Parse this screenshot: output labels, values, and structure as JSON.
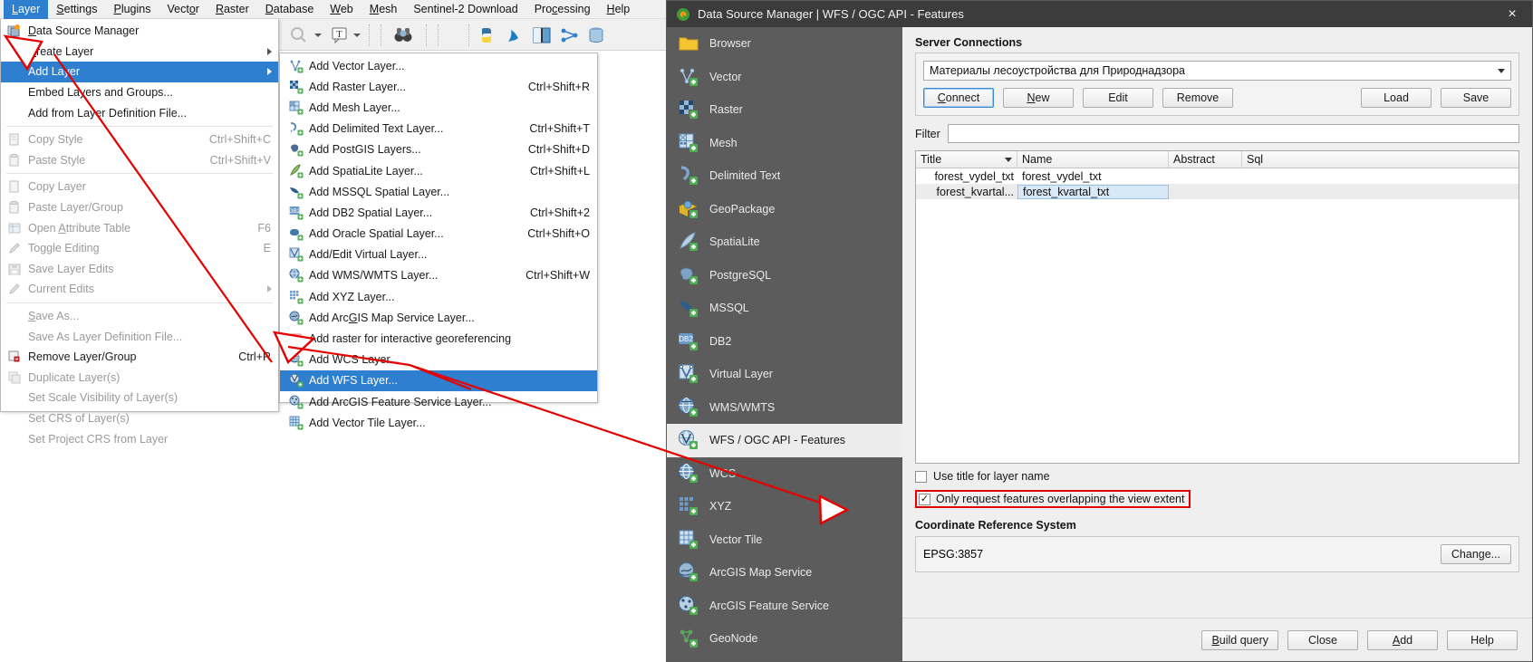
{
  "app": {
    "menubar": [
      {
        "label": "Layer",
        "accel": "L",
        "active": true
      },
      {
        "label": "Settings",
        "accel": "S",
        "active": false
      },
      {
        "label": "Plugins",
        "accel": "P",
        "active": false
      },
      {
        "label": "Vector",
        "accel": "o",
        "active": false
      },
      {
        "label": "Raster",
        "accel": "R",
        "active": false
      },
      {
        "label": "Database",
        "accel": "D",
        "active": false
      },
      {
        "label": "Web",
        "accel": "W",
        "active": false
      },
      {
        "label": "Mesh",
        "accel": "M",
        "active": false
      },
      {
        "label": "Sentinel-2 Download",
        "accel": "",
        "active": false
      },
      {
        "label": "Processing",
        "accel": "c",
        "active": false
      },
      {
        "label": "Help",
        "accel": "H",
        "active": false
      }
    ]
  },
  "layer_menu": {
    "items": [
      {
        "label": "Data Source Manager",
        "shortcut": "",
        "icon": "data-source-manager-icon",
        "disabled": false,
        "selected": false,
        "submenu": false,
        "sep_after": false
      },
      {
        "label": "Create Layer",
        "shortcut": "",
        "icon": "",
        "disabled": false,
        "selected": false,
        "submenu": true,
        "sep_after": false
      },
      {
        "label": "Add Layer",
        "shortcut": "",
        "icon": "",
        "disabled": false,
        "selected": true,
        "submenu": true,
        "sep_after": false
      },
      {
        "label": "Embed Layers and Groups...",
        "shortcut": "",
        "icon": "",
        "disabled": false,
        "selected": false,
        "submenu": false,
        "sep_after": false
      },
      {
        "label": "Add from Layer Definition File...",
        "shortcut": "",
        "icon": "",
        "disabled": false,
        "selected": false,
        "submenu": false,
        "sep_after": true
      },
      {
        "label": "Copy Style",
        "shortcut": "Ctrl+Shift+C",
        "icon": "copy-style-icon",
        "disabled": true,
        "selected": false,
        "submenu": false,
        "sep_after": false
      },
      {
        "label": "Paste Style",
        "shortcut": "Ctrl+Shift+V",
        "icon": "paste-style-icon",
        "disabled": true,
        "selected": false,
        "submenu": false,
        "sep_after": true
      },
      {
        "label": "Copy Layer",
        "shortcut": "",
        "icon": "copy-layer-icon",
        "disabled": true,
        "selected": false,
        "submenu": false,
        "sep_after": false
      },
      {
        "label": "Paste Layer/Group",
        "shortcut": "",
        "icon": "paste-layer-icon",
        "disabled": true,
        "selected": false,
        "submenu": false,
        "sep_after": false
      },
      {
        "label": "Open Attribute Table",
        "shortcut": "F6",
        "icon": "attribute-table-icon",
        "disabled": true,
        "selected": false,
        "submenu": false,
        "sep_after": false
      },
      {
        "label": "Toggle Editing",
        "shortcut": "E",
        "icon": "pencil-icon",
        "disabled": true,
        "selected": false,
        "submenu": false,
        "sep_after": false
      },
      {
        "label": "Save Layer Edits",
        "shortcut": "",
        "icon": "save-icon",
        "disabled": true,
        "selected": false,
        "submenu": false,
        "sep_after": false
      },
      {
        "label": "Current Edits",
        "shortcut": "",
        "icon": "current-edits-icon",
        "disabled": true,
        "selected": false,
        "submenu": true,
        "sep_after": true
      },
      {
        "label": "Save As...",
        "shortcut": "",
        "icon": "",
        "disabled": true,
        "selected": false,
        "submenu": false,
        "sep_after": false
      },
      {
        "label": "Save As Layer Definition File...",
        "shortcut": "",
        "icon": "",
        "disabled": true,
        "selected": false,
        "submenu": false,
        "sep_after": false
      },
      {
        "label": "Remove Layer/Group",
        "shortcut": "Ctrl+R",
        "icon": "remove-layer-icon",
        "disabled": false,
        "selected": false,
        "submenu": false,
        "sep_after": false
      },
      {
        "label": "Duplicate Layer(s)",
        "shortcut": "",
        "icon": "duplicate-layer-icon",
        "disabled": true,
        "selected": false,
        "submenu": false,
        "sep_after": false
      },
      {
        "label": "Set Scale Visibility of Layer(s)",
        "shortcut": "",
        "icon": "",
        "disabled": true,
        "selected": false,
        "submenu": false,
        "sep_after": false
      },
      {
        "label": "Set CRS of Layer(s)",
        "shortcut": "",
        "icon": "",
        "disabled": true,
        "selected": false,
        "submenu": false,
        "sep_after": false
      },
      {
        "label": "Set Project CRS from Layer",
        "shortcut": "",
        "icon": "",
        "disabled": true,
        "selected": false,
        "submenu": false,
        "sep_after": false
      }
    ]
  },
  "add_layer_submenu": {
    "items": [
      {
        "label": "Add Vector Layer...",
        "shortcut": "",
        "icon": "vector-icon",
        "selected": false
      },
      {
        "label": "Add Raster Layer...",
        "shortcut": "Ctrl+Shift+R",
        "icon": "raster-icon",
        "selected": false
      },
      {
        "label": "Add Mesh Layer...",
        "shortcut": "",
        "icon": "mesh-icon",
        "selected": false
      },
      {
        "label": "Add Delimited Text Layer...",
        "shortcut": "Ctrl+Shift+T",
        "icon": "delimited-text-icon",
        "selected": false
      },
      {
        "label": "Add PostGIS Layers...",
        "shortcut": "Ctrl+Shift+D",
        "icon": "postgis-icon",
        "selected": false
      },
      {
        "label": "Add SpatiaLite Layer...",
        "shortcut": "Ctrl+Shift+L",
        "icon": "spatialite-icon",
        "selected": false
      },
      {
        "label": "Add MSSQL Spatial Layer...",
        "shortcut": "",
        "icon": "mssql-icon",
        "selected": false
      },
      {
        "label": "Add DB2 Spatial Layer...",
        "shortcut": "Ctrl+Shift+2",
        "icon": "db2-icon",
        "selected": false
      },
      {
        "label": "Add Oracle Spatial Layer...",
        "shortcut": "Ctrl+Shift+O",
        "icon": "oracle-icon",
        "selected": false
      },
      {
        "label": "Add/Edit Virtual Layer...",
        "shortcut": "",
        "icon": "virtual-layer-icon",
        "selected": false
      },
      {
        "label": "Add WMS/WMTS Layer...",
        "shortcut": "Ctrl+Shift+W",
        "icon": "wms-icon",
        "selected": false
      },
      {
        "label": "Add XYZ Layer...",
        "shortcut": "",
        "icon": "xyz-icon",
        "selected": false
      },
      {
        "label": "Add ArcGIS Map Service Layer...",
        "shortcut": "",
        "icon": "arcgis-map-service-icon",
        "selected": false
      },
      {
        "label": "Add raster for interactive georeferencing",
        "shortcut": "",
        "icon": "ad-icon",
        "selected": false
      },
      {
        "label": "Add WCS Layer...",
        "shortcut": "",
        "icon": "wcs-icon",
        "selected": false
      },
      {
        "label": "Add WFS Layer...",
        "shortcut": "",
        "icon": "wfs-icon",
        "selected": true
      },
      {
        "label": "Add ArcGIS Feature Service Layer...",
        "shortcut": "",
        "icon": "arcgis-feature-service-icon",
        "selected": false
      },
      {
        "label": "Add Vector Tile Layer...",
        "shortcut": "",
        "icon": "vector-tile-icon",
        "selected": false
      }
    ]
  },
  "dialog": {
    "title": "Data Source Manager | WFS / OGC API - Features",
    "close_icon": "×",
    "sidebar": [
      {
        "label": "Browser",
        "icon": "folder-icon",
        "active": false
      },
      {
        "label": "Vector",
        "icon": "vector-icon",
        "active": false
      },
      {
        "label": "Raster",
        "icon": "raster-icon",
        "active": false
      },
      {
        "label": "Mesh",
        "icon": "mesh-icon",
        "active": false
      },
      {
        "label": "Delimited Text",
        "icon": "delimited-text-icon",
        "active": false
      },
      {
        "label": "GeoPackage",
        "icon": "geopackage-icon",
        "active": false
      },
      {
        "label": "SpatiaLite",
        "icon": "spatialite-icon",
        "active": false
      },
      {
        "label": "PostgreSQL",
        "icon": "postgresql-icon",
        "active": false
      },
      {
        "label": "MSSQL",
        "icon": "mssql-icon",
        "active": false
      },
      {
        "label": "DB2",
        "icon": "db2-icon",
        "active": false
      },
      {
        "label": "Virtual Layer",
        "icon": "virtual-layer-icon",
        "active": false
      },
      {
        "label": "WMS/WMTS",
        "icon": "wms-icon",
        "active": false
      },
      {
        "label": "WFS / OGC API - Features",
        "icon": "wfs-icon",
        "active": true
      },
      {
        "label": "WCS",
        "icon": "wcs-icon",
        "active": false
      },
      {
        "label": "XYZ",
        "icon": "xyz-icon",
        "active": false
      },
      {
        "label": "Vector Tile",
        "icon": "vector-tile-icon",
        "active": false
      },
      {
        "label": "ArcGIS Map Service",
        "icon": "arcgis-map-service-icon",
        "active": false
      },
      {
        "label": "ArcGIS Feature Service",
        "icon": "arcgis-feature-service-icon",
        "active": false
      },
      {
        "label": "GeoNode",
        "icon": "geonode-icon",
        "active": false
      }
    ],
    "server_connections": {
      "title": "Server Connections",
      "selected_connection": "Материалы лесоустройства для Природнадзора",
      "buttons": {
        "connect": "Connect",
        "new": "New",
        "edit": "Edit",
        "remove": "Remove",
        "load": "Load",
        "save": "Save"
      }
    },
    "filter": {
      "label": "Filter",
      "value": "",
      "placeholder": ""
    },
    "table": {
      "columns": [
        "Title",
        "Name",
        "Abstract",
        "Sql"
      ],
      "sorted_column": "Title",
      "rows": [
        {
          "title": "forest_vydel_txt",
          "name": "forest_vydel_txt",
          "abstract": "",
          "sql": "",
          "selected": false
        },
        {
          "title": "forest_kvartal...",
          "name": "forest_kvartal_txt",
          "abstract": "",
          "sql": "",
          "selected": true
        }
      ]
    },
    "options": {
      "use_title_for_layer_name": {
        "label": "Use title for layer name",
        "checked": false,
        "mark": ""
      },
      "only_request_features": {
        "label": "Only request features overlapping the view extent",
        "checked": true,
        "mark": "✓",
        "highlight_color": "#e10000"
      }
    },
    "crs": {
      "title": "Coordinate Reference System",
      "value": "EPSG:3857",
      "change_button": "Change..."
    },
    "footer": {
      "build_query": "Build query",
      "close": "Close",
      "add": "Add",
      "help": "Help"
    }
  },
  "annotations": {
    "color": "#e60000",
    "notes": [
      "arrow-to-add-layer",
      "arrow-to-add-wfs-layer",
      "arrow-to-only-request-features-checkbox"
    ]
  }
}
